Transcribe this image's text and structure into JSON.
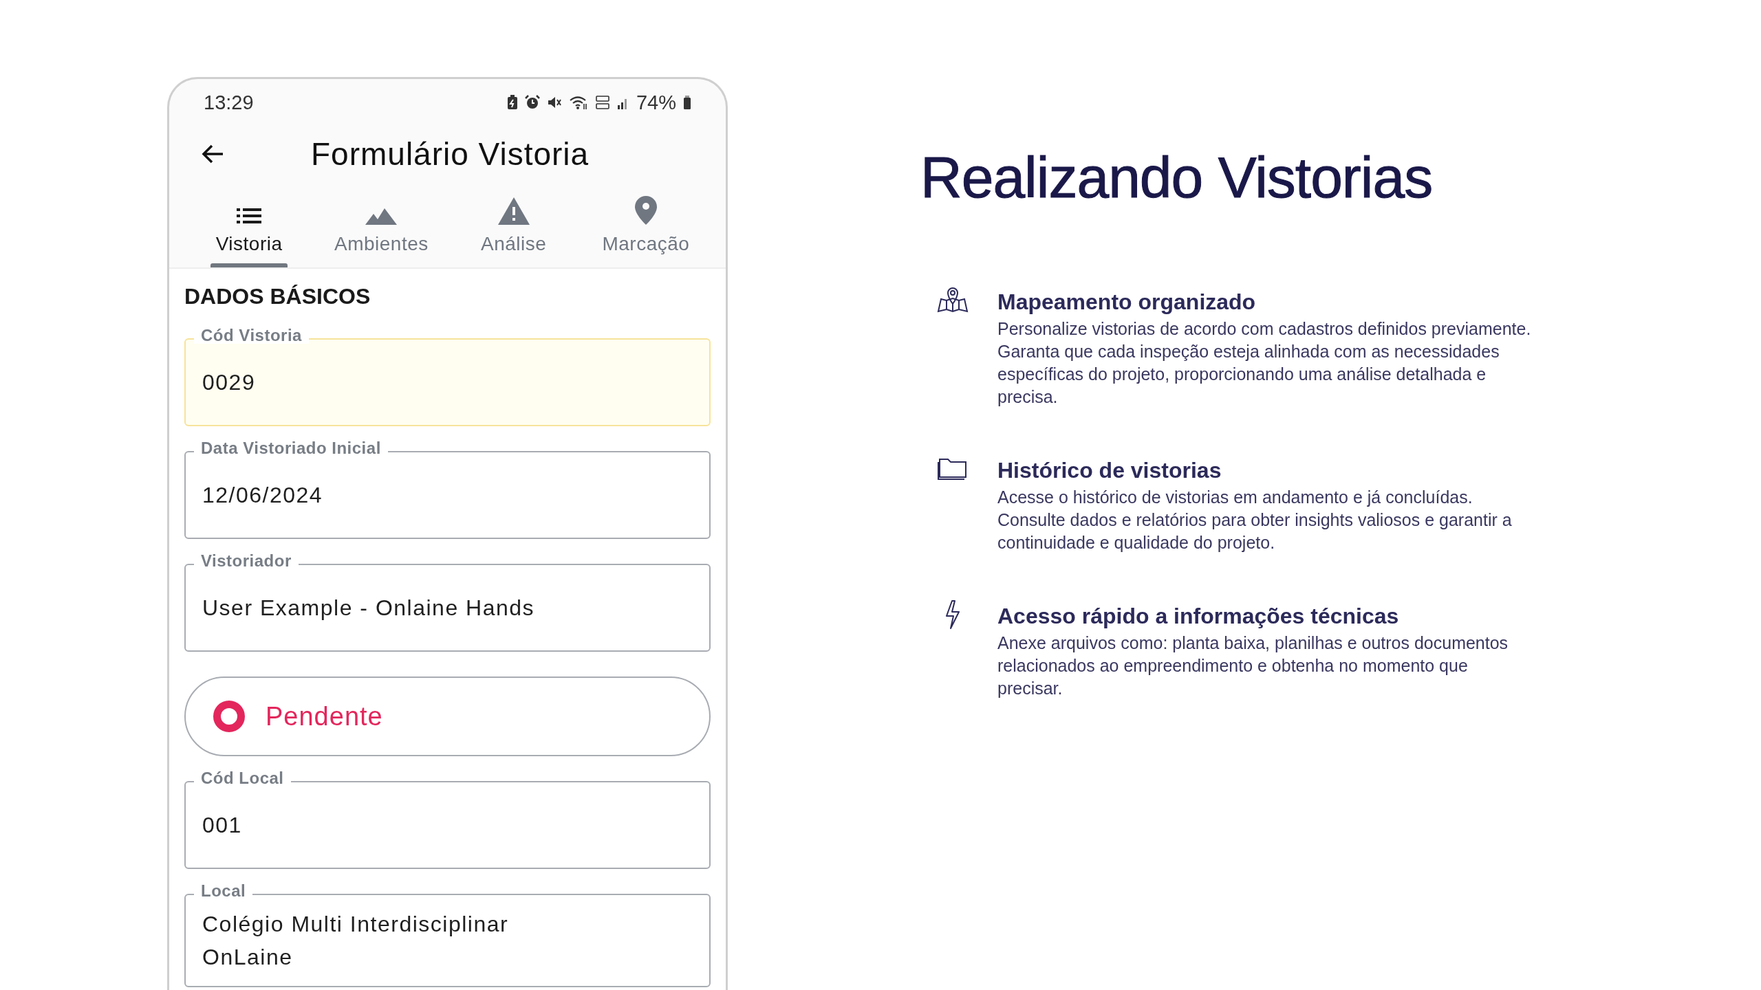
{
  "phone": {
    "status_bar": {
      "time": "13:29",
      "battery": "74%"
    },
    "app_bar": {
      "title": "Formulário Vistoria"
    },
    "tabs": [
      {
        "label": "Vistoria",
        "selected": true
      },
      {
        "label": "Ambientes",
        "selected": false
      },
      {
        "label": "Análise",
        "selected": false
      },
      {
        "label": "Marcação",
        "selected": false
      }
    ],
    "section_title": "DADOS BÁSICOS",
    "fields": [
      {
        "kind": "field",
        "label": "Cód Vistoria",
        "value": "0029",
        "highlighted": true
      },
      {
        "kind": "field",
        "label": "Data Vistoriado Inicial",
        "value": "12/06/2024",
        "highlighted": false
      },
      {
        "kind": "field",
        "label": "Vistoriador",
        "value": "User Example - Onlaine Hands",
        "highlighted": false
      },
      {
        "kind": "status",
        "value": "Pendente",
        "color": "#e3265c"
      },
      {
        "kind": "field",
        "label": "Cód Local",
        "value": "001",
        "highlighted": false
      },
      {
        "kind": "field",
        "label": "Local",
        "value": "Colégio Multi Interdisciplinar OnLaine",
        "highlighted": false
      }
    ]
  },
  "headline": "Realizando Vistorias",
  "features": [
    {
      "title": "Mapeamento organizado",
      "description": "Personalize vistorias de acordo com cadastros definidos previamente. Garanta que cada inspeção esteja alinhada com as necessidades específicas do projeto, proporcionando uma análise detalhada e precisa."
    },
    {
      "title": "Histórico de vistorias",
      "description": "Acesse o histórico de vistorias em andamento e já concluídas. Consulte dados e relatórios para obter insights valiosos e garantir a continuidade e qualidade do projeto."
    },
    {
      "title": "Acesso rápido a informações técnicas",
      "description": "Anexe arquivos como: planta baixa, planilhas e outros documentos relacionados ao empreendimento e obtenha no momento que precisar."
    }
  ]
}
